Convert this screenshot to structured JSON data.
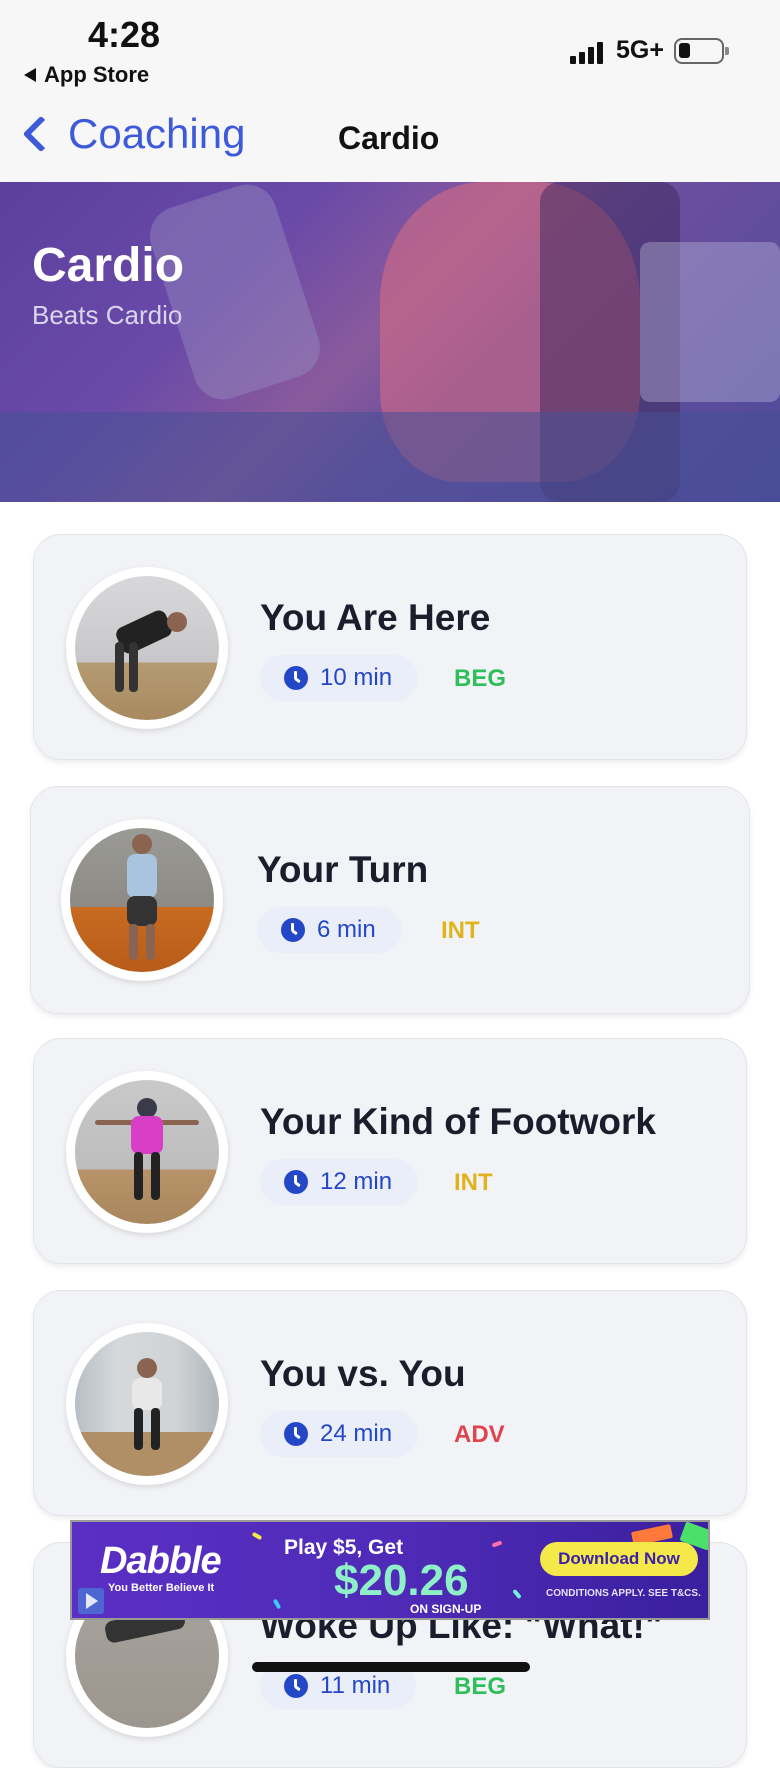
{
  "status_bar": {
    "time": "4:28",
    "back_app": "App Store",
    "network": "5G+"
  },
  "nav": {
    "back_label": "Coaching",
    "title": "Cardio"
  },
  "hero": {
    "title": "Cardio",
    "subtitle": "Beats Cardio"
  },
  "workouts": [
    {
      "title": "You Are Here",
      "duration": "10 min",
      "level": "BEG",
      "level_color": "#2fbf5a"
    },
    {
      "title": "Your Turn",
      "duration": "6 min",
      "level": "INT",
      "level_color": "#e0b21d"
    },
    {
      "title": "Your Kind of Footwork",
      "duration": "12 min",
      "level": "INT",
      "level_color": "#e0b21d"
    },
    {
      "title": "You vs. You",
      "duration": "24 min",
      "level": "ADV",
      "level_color": "#e0434d"
    },
    {
      "title": "Woke Up Like: \"What!\"",
      "duration": "11 min",
      "level": "BEG",
      "level_color": "#2fbf5a"
    }
  ],
  "ad": {
    "brand": "Dabble",
    "tagline": "You Better Believe It",
    "offer_line": "Play $5, Get",
    "amount": "$20.26",
    "signup": "ON SIGN-UP",
    "cta": "Download Now",
    "terms": "CONDITIONS APPLY. SEE T&CS."
  },
  "colors": {
    "accent": "#3d5bd9",
    "duration": "#2447c8",
    "hero_overlay": "#5b3f9e"
  }
}
